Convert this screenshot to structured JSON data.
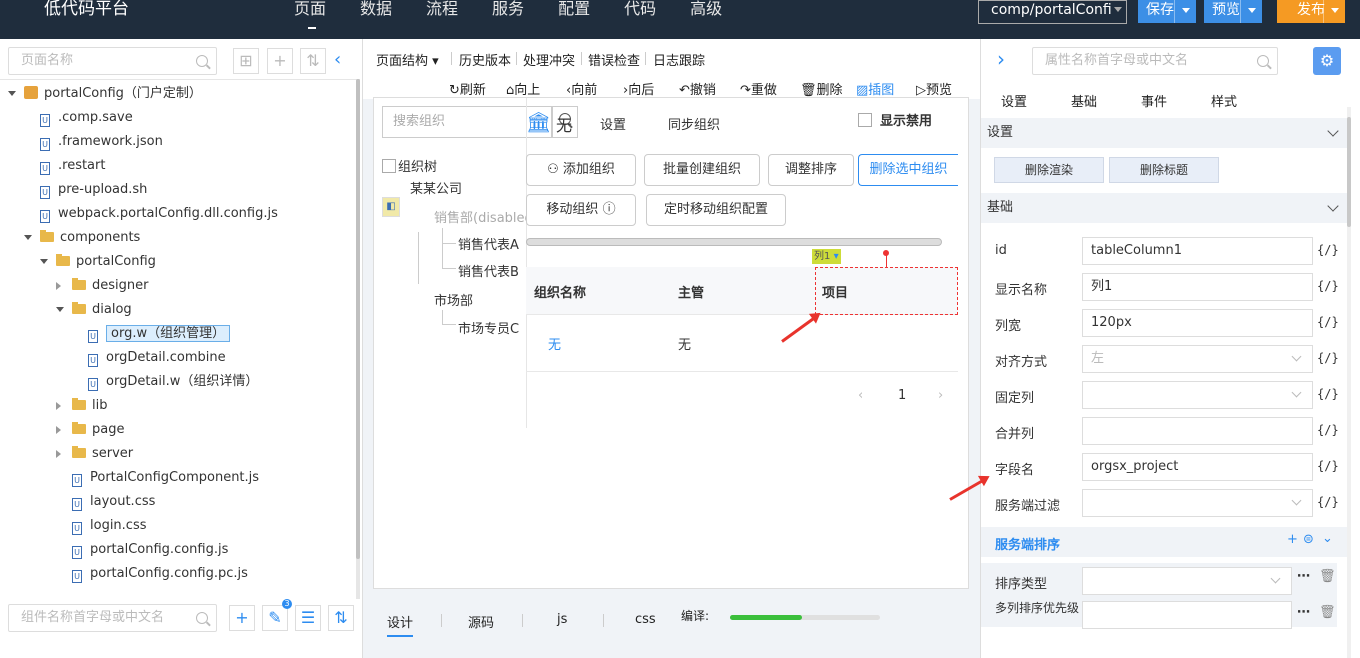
{
  "app": {
    "title": "低代码平台",
    "nav": [
      "页面",
      "数据",
      "流程",
      "服务",
      "配置",
      "代码",
      "高级"
    ],
    "project": "comp/portalConfi",
    "save": "保存",
    "preview": "预览",
    "publish": "发布"
  },
  "left": {
    "search_placeholder": "页面名称",
    "bottom_search_placeholder": "组件名称首字母或中文名",
    "badge": "3",
    "tree": [
      {
        "label": "portalConfig（门户定制）"
      },
      {
        "label": ".comp.save"
      },
      {
        "label": ".framework.json"
      },
      {
        "label": ".restart"
      },
      {
        "label": "pre-upload.sh"
      },
      {
        "label": "webpack.portalConfig.dll.config.js"
      },
      {
        "label": "components"
      },
      {
        "label": "portalConfig"
      },
      {
        "label": "designer"
      },
      {
        "label": "dialog"
      },
      {
        "label": "org.w（组织管理）"
      },
      {
        "label": "orgDetail.combine"
      },
      {
        "label": "orgDetail.w（组织详情）"
      },
      {
        "label": "lib"
      },
      {
        "label": "page"
      },
      {
        "label": "server"
      },
      {
        "label": "PortalConfigComponent.js"
      },
      {
        "label": "layout.css"
      },
      {
        "label": "login.css"
      },
      {
        "label": "portalConfig.config.js"
      },
      {
        "label": "portalConfig.config.pc.js"
      }
    ]
  },
  "middle": {
    "menu": [
      "页面结构",
      "历史版本",
      "处理冲突",
      "错误检查",
      "日志跟踪"
    ],
    "actions": [
      "刷新",
      "向上",
      "向前",
      "向后",
      "撤销",
      "重做",
      "删除",
      "插图",
      "预览"
    ],
    "canvas": {
      "tree_search_placeholder": "搜索组织",
      "org_tree_label": "组织树",
      "company": "某某公司",
      "sales_dept": "销售部(disabled",
      "rep_a": "销售代表A",
      "rep_b": "销售代表B",
      "market_dept": "市场部",
      "market_staff": "市场专员C",
      "bank_none": "无",
      "settings": "设置",
      "sync_org": "同步组织",
      "show_disabled": "显示禁用",
      "buttons": [
        "添加组织",
        "批量创建组织",
        "调整排序",
        "删除选中组织",
        "移动组织",
        "定时移动组织配置"
      ],
      "col_tag": "列1",
      "table": {
        "headers": [
          "组织名称",
          "主管",
          "项目"
        ],
        "row": [
          "无",
          "无"
        ]
      },
      "page": "1"
    },
    "bottom": {
      "tabs": [
        "设计",
        "源码",
        "js",
        "css"
      ],
      "compile_label": "编译:",
      "compile_progress": 0.48
    }
  },
  "right": {
    "search_placeholder": "属性名称首字母或中文名",
    "tabs": [
      "设置",
      "基础",
      "事件",
      "样式"
    ],
    "section_settings": "设置",
    "btn_remove_render": "删除渲染",
    "btn_remove_title": "删除标题",
    "section_basic": "基础",
    "props": [
      {
        "label": "id",
        "value": "tableColumn1"
      },
      {
        "label": "显示名称",
        "value": "列1"
      },
      {
        "label": "列宽",
        "value": "120px"
      },
      {
        "label": "对齐方式",
        "value": "左"
      },
      {
        "label": "固定列",
        "value": ""
      },
      {
        "label": "合并列",
        "value": ""
      },
      {
        "label": "字段名",
        "value": "orgsx_project"
      },
      {
        "label": "服务端过滤",
        "value": ""
      }
    ],
    "expr": "{/}",
    "section_sort": "服务端排序",
    "sort_type_label": "排序类型",
    "multi_sort_label": "多列排序优先级"
  }
}
